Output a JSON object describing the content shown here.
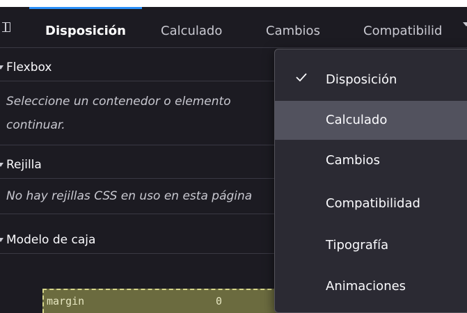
{
  "tabs": [
    {
      "label": "Disposición",
      "selected": true
    },
    {
      "label": "Calculado",
      "selected": false
    },
    {
      "label": "Cambios",
      "selected": false
    },
    {
      "label": "Compatibilid",
      "selected": false
    }
  ],
  "sections": {
    "flexbox": {
      "title": "Flexbox",
      "message_line1": "Seleccione un contenedor o elemento",
      "message_line2": "continuar."
    },
    "grid": {
      "title": "Rejilla",
      "message": "No hay rejillas CSS en uso en esta página"
    },
    "boxmodel": {
      "title": "Modelo de caja",
      "margin_label": "margin",
      "margin_value": "0"
    }
  },
  "menu": {
    "items": [
      {
        "label": "Disposición",
        "checked": true,
        "hovered": false
      },
      {
        "label": "Calculado",
        "checked": false,
        "hovered": true
      },
      {
        "label": "Cambios",
        "checked": false,
        "hovered": false
      },
      {
        "label": "Compatibilidad",
        "checked": false,
        "hovered": false
      },
      {
        "label": "Tipografía",
        "checked": false,
        "hovered": false
      },
      {
        "label": "Animaciones",
        "checked": false,
        "hovered": false
      }
    ]
  },
  "colors": {
    "accent": "#2a8ff7",
    "panel_bg": "#1c1b22",
    "menu_bg": "#2b2a33",
    "menu_hover": "#52525e",
    "margin_fill": "#6b6b3f"
  }
}
